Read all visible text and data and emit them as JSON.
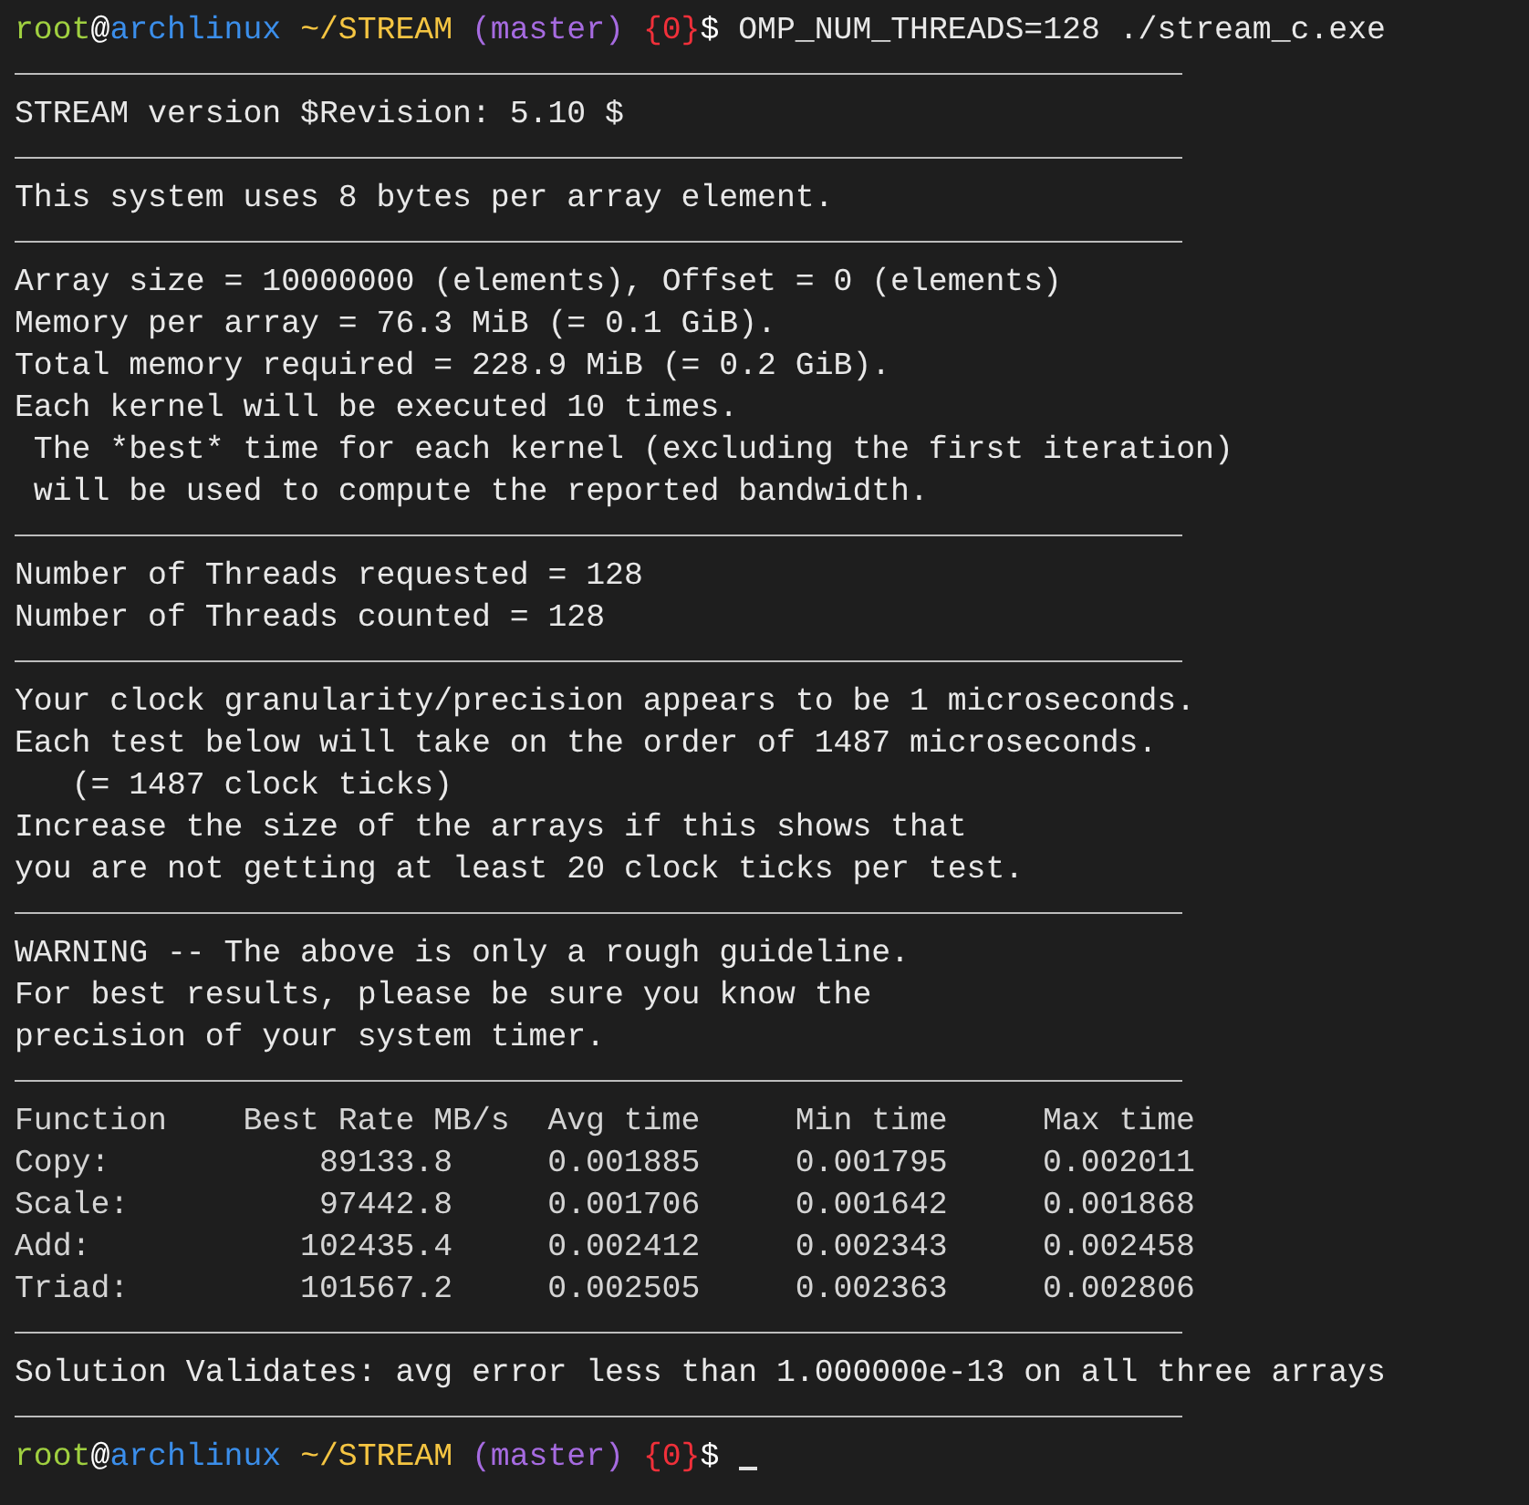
{
  "lines": [
    {
      "kind": "prompt",
      "user": "root",
      "at": "@",
      "host": "archlinux",
      "path": "~/STREAM",
      "branch": "(master)",
      "status": "{0}",
      "symbol": "$",
      "command": "OMP_NUM_THREADS=128 ./stream_c.exe",
      "cursor": false
    },
    {
      "kind": "rule"
    },
    {
      "kind": "text",
      "text": "STREAM version $Revision: 5.10 $"
    },
    {
      "kind": "rule"
    },
    {
      "kind": "text",
      "text": "This system uses 8 bytes per array element."
    },
    {
      "kind": "rule"
    },
    {
      "kind": "text",
      "text": "Array size = 10000000 (elements), Offset = 0 (elements)"
    },
    {
      "kind": "text",
      "text": "Memory per array = 76.3 MiB (= 0.1 GiB)."
    },
    {
      "kind": "text",
      "text": "Total memory required = 228.9 MiB (= 0.2 GiB)."
    },
    {
      "kind": "text",
      "text": "Each kernel will be executed 10 times."
    },
    {
      "kind": "text",
      "text": " The *best* time for each kernel (excluding the first iteration)"
    },
    {
      "kind": "text",
      "text": " will be used to compute the reported bandwidth."
    },
    {
      "kind": "rule"
    },
    {
      "kind": "text",
      "text": "Number of Threads requested = 128"
    },
    {
      "kind": "text",
      "text": "Number of Threads counted = 128"
    },
    {
      "kind": "rule"
    },
    {
      "kind": "text",
      "text": "Your clock granularity/precision appears to be 1 microseconds."
    },
    {
      "kind": "text",
      "text": "Each test below will take on the order of 1487 microseconds."
    },
    {
      "kind": "text",
      "text": "   (= 1487 clock ticks)"
    },
    {
      "kind": "text",
      "text": "Increase the size of the arrays if this shows that"
    },
    {
      "kind": "text",
      "text": "you are not getting at least 20 clock ticks per test."
    },
    {
      "kind": "rule"
    },
    {
      "kind": "text",
      "text": "WARNING -- The above is only a rough guideline."
    },
    {
      "kind": "text",
      "text": "For best results, please be sure you know the"
    },
    {
      "kind": "text",
      "text": "precision of your system timer."
    },
    {
      "kind": "rule"
    },
    {
      "kind": "table",
      "columns": [
        "Function",
        "Best Rate MB/s",
        "Avg time",
        "Min time",
        "Max time"
      ],
      "rows": [
        [
          "Copy:",
          "89133.8",
          "0.001885",
          "0.001795",
          "0.002011"
        ],
        [
          "Scale:",
          "97442.8",
          "0.001706",
          "0.001642",
          "0.001868"
        ],
        [
          "Add:",
          "102435.4",
          "0.002412",
          "0.002343",
          "0.002458"
        ],
        [
          "Triad:",
          "101567.2",
          "0.002505",
          "0.002363",
          "0.002806"
        ]
      ]
    },
    {
      "kind": "rule"
    },
    {
      "kind": "text",
      "text": "Solution Validates: avg error less than 1.000000e-13 on all three arrays"
    },
    {
      "kind": "rule"
    },
    {
      "kind": "prompt",
      "user": "root",
      "at": "@",
      "host": "archlinux",
      "path": "~/STREAM",
      "branch": "(master)",
      "status": "{0}",
      "symbol": "$",
      "cursor": true
    }
  ]
}
